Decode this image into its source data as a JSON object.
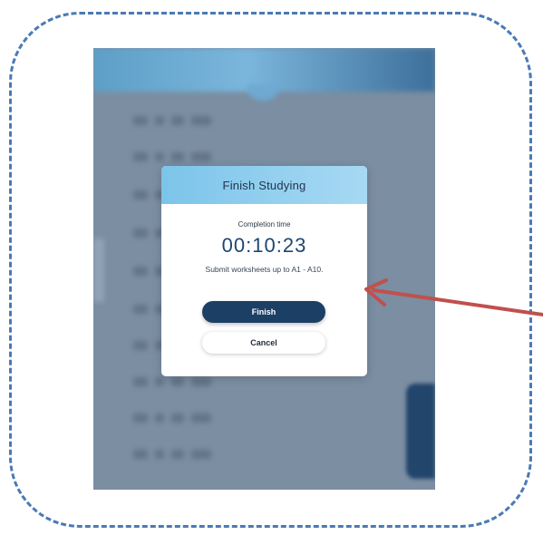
{
  "dialog": {
    "title": "Finish Studying",
    "caption": "Completion time",
    "time": "00:10:23",
    "message": "Submit worksheets up to A1 - A10.",
    "finish_label": "Finish",
    "cancel_label": "Cancel"
  },
  "colors": {
    "frame_border": "#4a7ab5",
    "header_gradient": [
      "#7cc4ea",
      "#a7d9f3"
    ],
    "finish_button": "#1c3f66",
    "arrow": "#c0504d",
    "backdrop": "#7b8ea2"
  },
  "annotation": {
    "icon": "arrow-pointing-left-icon"
  }
}
